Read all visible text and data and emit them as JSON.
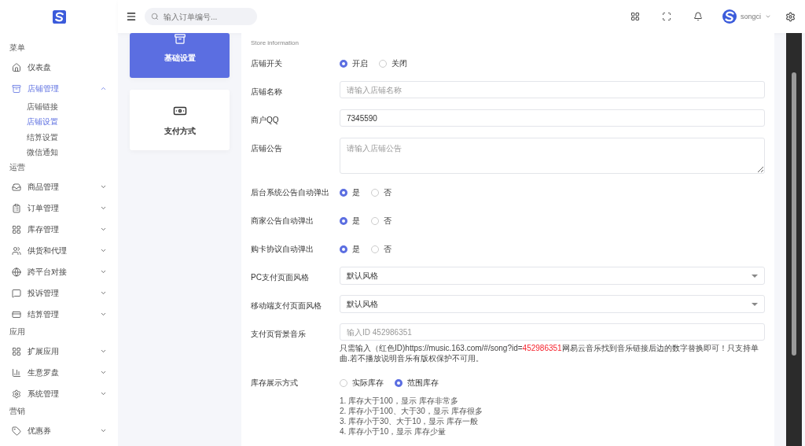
{
  "header": {
    "search_placeholder": "输入订单编号...",
    "user_name": "songci"
  },
  "sidebar": [
    {
      "title": "菜单",
      "items": [
        {
          "label": "仪表盘",
          "selected": false
        },
        {
          "label": "店铺管理",
          "selected": true,
          "expanded": true,
          "children": [
            {
              "label": "店铺链接",
              "selected": false
            },
            {
              "label": "店铺设置",
              "selected": true
            },
            {
              "label": "结算设置",
              "selected": false
            },
            {
              "label": "微信通知",
              "selected": false
            }
          ]
        }
      ]
    },
    {
      "title": "运营",
      "items": [
        {
          "label": "商品管理",
          "selected": false,
          "expanded": false
        },
        {
          "label": "订单管理",
          "selected": false,
          "expanded": false
        },
        {
          "label": "库存管理",
          "selected": false,
          "expanded": false
        },
        {
          "label": "供货和代理",
          "selected": false,
          "expanded": false
        },
        {
          "label": "跨平台对接",
          "selected": false,
          "expanded": false
        },
        {
          "label": "投诉管理",
          "selected": false,
          "expanded": false
        },
        {
          "label": "结算管理",
          "selected": false,
          "expanded": false
        }
      ]
    },
    {
      "title": "应用",
      "items": [
        {
          "label": "扩展应用",
          "selected": false,
          "expanded": false
        },
        {
          "label": "生意罗盘",
          "selected": false,
          "expanded": false
        },
        {
          "label": "系统管理",
          "selected": false,
          "expanded": false
        }
      ]
    },
    {
      "title": "营销",
      "items": [
        {
          "label": "优惠券",
          "selected": false,
          "expanded": false
        }
      ]
    }
  ],
  "tabs": [
    {
      "label": "基础设置",
      "selected": true
    },
    {
      "label": "支付方式",
      "selected": false
    }
  ],
  "form": {
    "subtitle": "Store information",
    "rows": [
      {
        "kind": "radio",
        "label": "店铺开关",
        "options": [
          {
            "label": "开启",
            "selected": true
          },
          {
            "label": "关闭",
            "selected": false
          }
        ]
      },
      {
        "kind": "text",
        "label": "店铺名称",
        "placeholder": "请输入店铺名称"
      },
      {
        "kind": "text",
        "label": "商户QQ",
        "value": "7345590"
      },
      {
        "kind": "textarea",
        "label": "店铺公告",
        "placeholder": "请输入店铺公告"
      },
      {
        "kind": "radio",
        "label": "后台系统公告自动弹出",
        "options": [
          {
            "label": "是",
            "selected": true
          },
          {
            "label": "否",
            "selected": false
          }
        ]
      },
      {
        "kind": "radio",
        "label": "商家公告自动弹出",
        "options": [
          {
            "label": "是",
            "selected": true
          },
          {
            "label": "否",
            "selected": false
          }
        ]
      },
      {
        "kind": "radio",
        "label": "购卡协议自动弹出",
        "options": [
          {
            "label": "是",
            "selected": true
          },
          {
            "label": "否",
            "selected": false
          }
        ]
      },
      {
        "kind": "select",
        "label": "PC支付页面风格",
        "value": "默认风格"
      },
      {
        "kind": "select",
        "label": "移动端支付页面风格",
        "value": "默认风格"
      },
      {
        "kind": "text",
        "label": "支付页背景音乐",
        "placeholder": "输入ID 452986351",
        "hint": {
          "before": "只需输入（红色ID)https://music.163.com/#/song?id=",
          "highlight": "452986351",
          "after": "网易云音乐找到音乐链接后边的数字替换即可！只支持单曲.若不播放说明音乐有版权保护不可用。"
        }
      },
      {
        "kind": "radio",
        "label": "库存展示方式",
        "options": [
          {
            "label": "实际库存",
            "selected": false
          },
          {
            "label": "范围库存",
            "selected": true
          }
        ],
        "notes": [
          "1. 库存大于100，显示 库存非常多",
          "2. 库存小于100、大于30，显示 库存很多",
          "3. 库存小于30、大于10，显示 库存一般",
          "4. 库存小于10，显示 库存少量"
        ]
      }
    ]
  }
}
